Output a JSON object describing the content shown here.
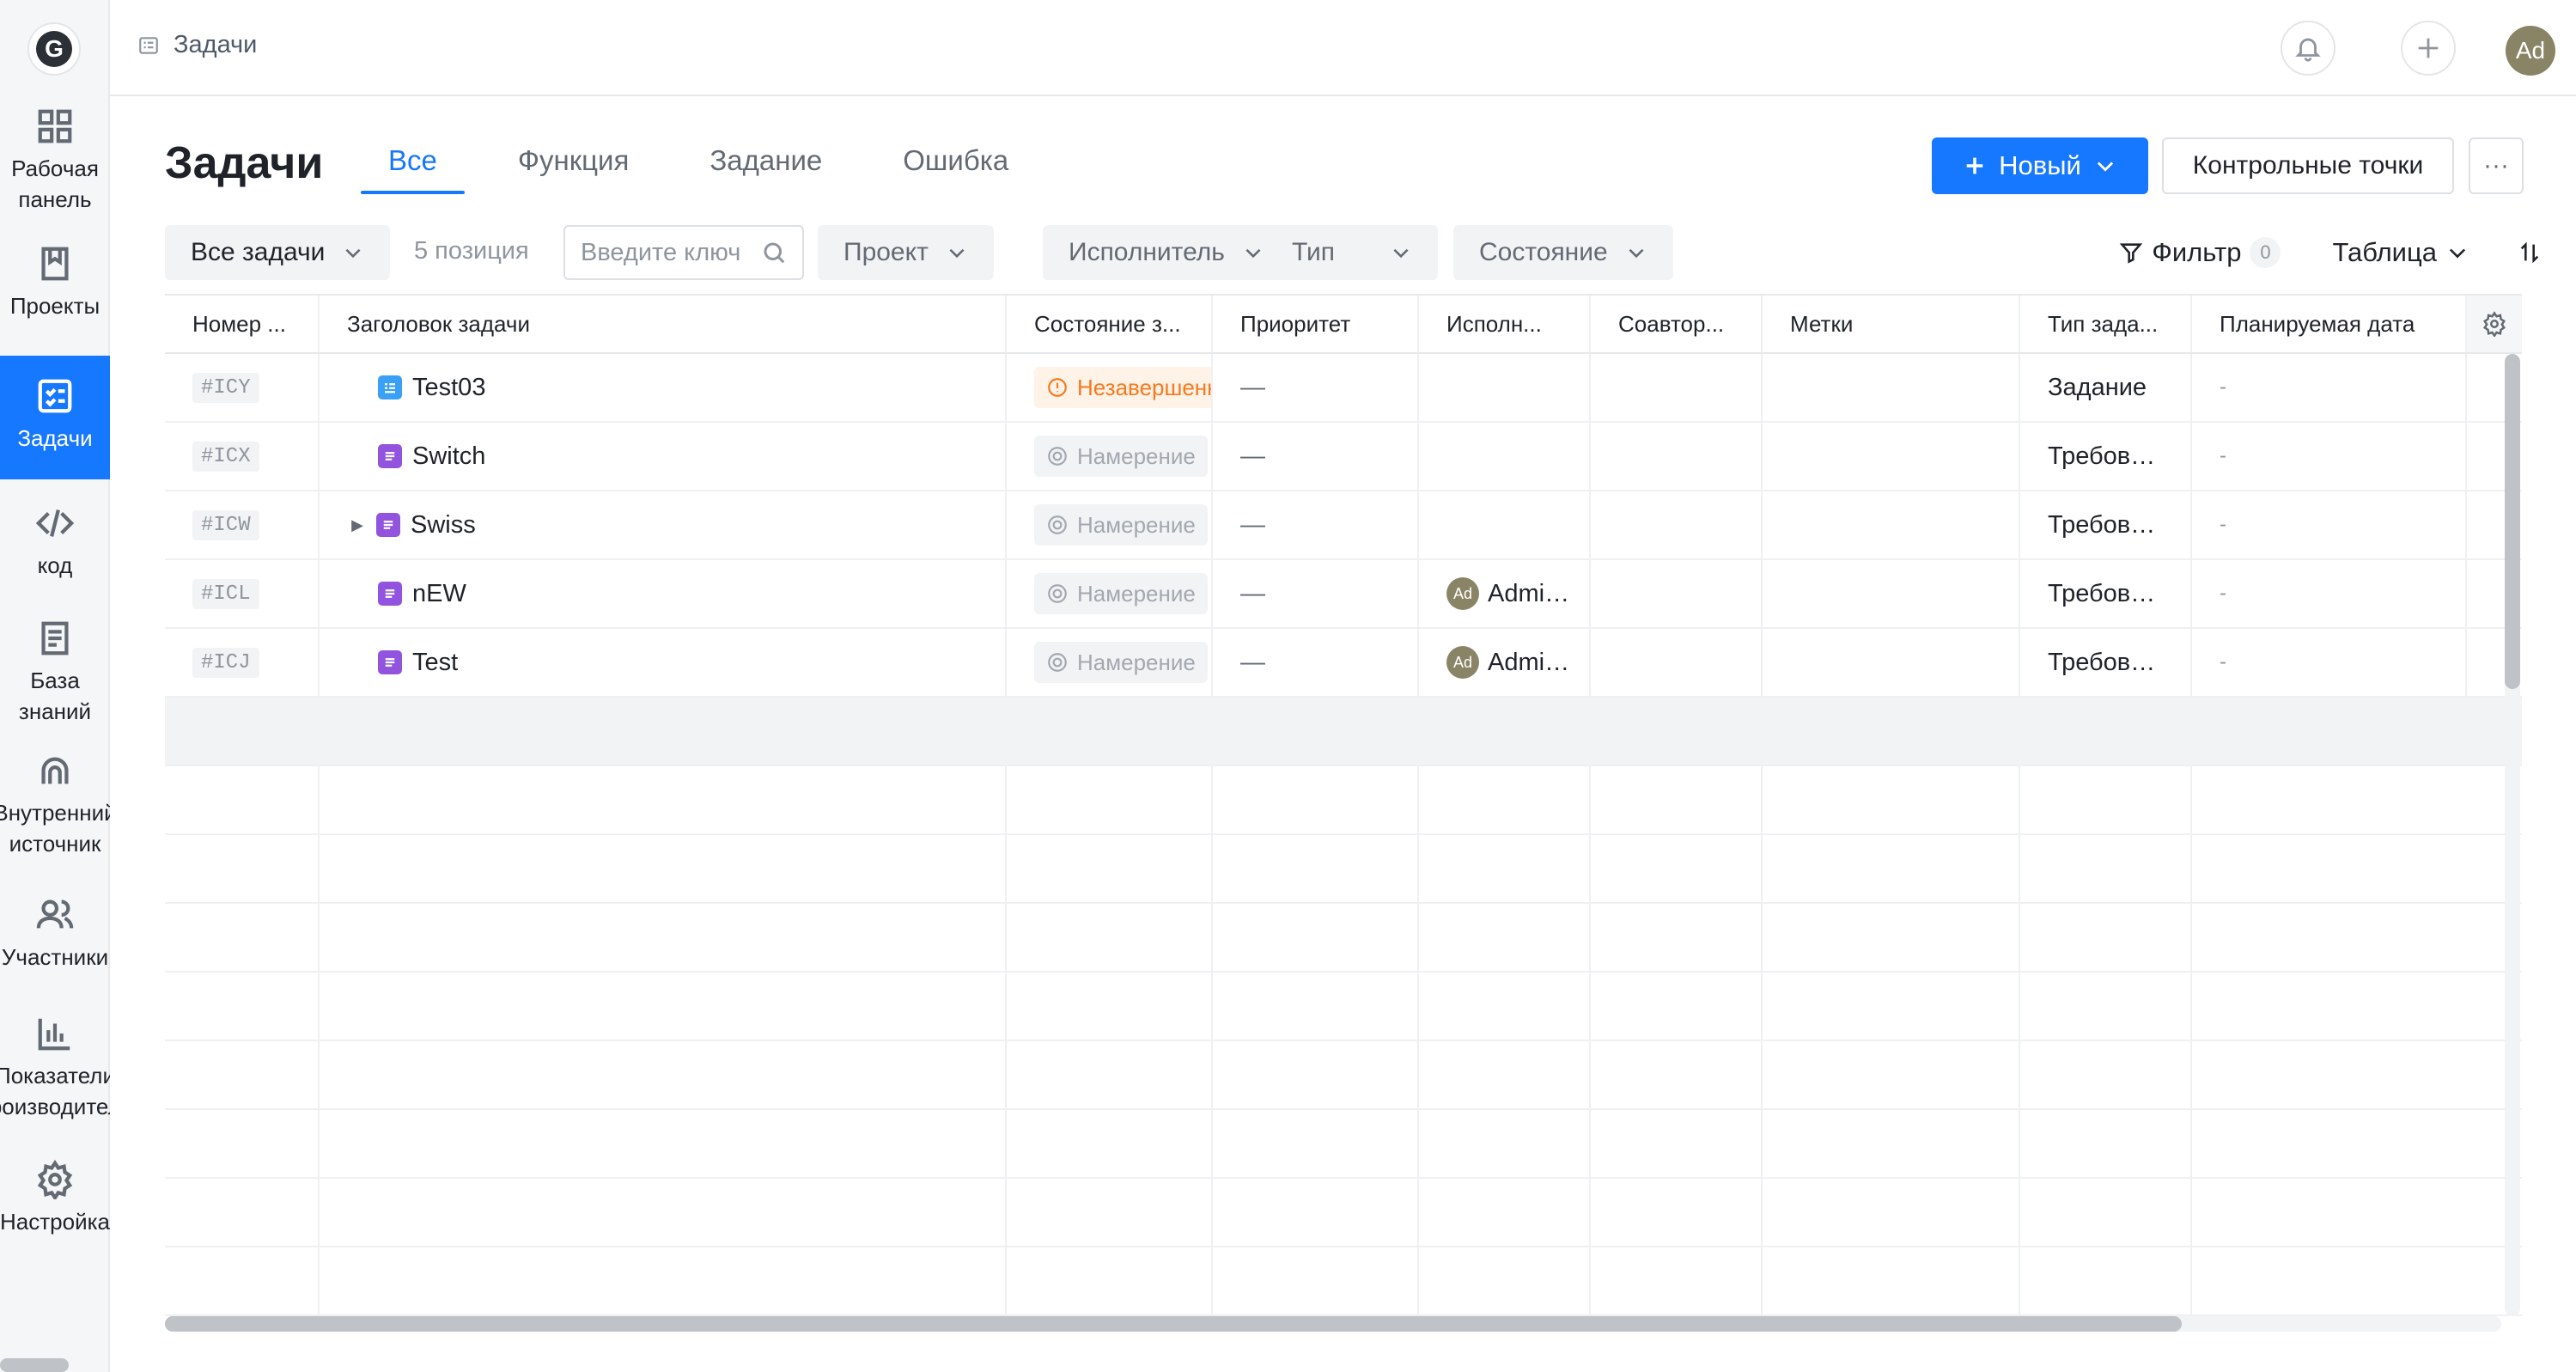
{
  "sidebar": {
    "logo_letter": "G",
    "items": [
      {
        "label": "Рабочая\nпанель",
        "icon": "dashboard-icon"
      },
      {
        "label": "Проекты",
        "icon": "book-icon"
      },
      {
        "label": "Задачи",
        "icon": "tasks-icon"
      },
      {
        "label": "код",
        "icon": "code-icon"
      },
      {
        "label": "База\nзнаний",
        "icon": "document-icon"
      },
      {
        "label": "Внутренний\nисточник",
        "icon": "source-icon"
      },
      {
        "label": "Участники",
        "icon": "members-icon"
      },
      {
        "label": "Показатели\nпроизводитель",
        "icon": "chart-icon"
      },
      {
        "label": "Настройка",
        "icon": "gear-icon"
      }
    ]
  },
  "topbar": {
    "breadcrumb": "Задачи",
    "avatar": "Ad"
  },
  "header": {
    "title": "Задачи",
    "tabs": [
      "Все",
      "Функция",
      "Задание",
      "Ошибка"
    ],
    "new_button": "Новый",
    "checkpoints_button": "Контрольные точки",
    "more_button": "···"
  },
  "filters": {
    "all_tasks": "Все задачи",
    "count": "5 позиция",
    "search_placeholder": "Введите ключ",
    "project": "Проект",
    "assignee": "Исполнитель",
    "type": "Тип",
    "state": "Состояние",
    "filter": "Фильтр",
    "filter_count": "0",
    "view": "Таблица"
  },
  "table": {
    "columns": [
      "Номер ...",
      "Заголовок задачи",
      "Состояние з...",
      "Приоритет",
      "Исполн...",
      "Соавтор...",
      "Метки",
      "Тип зада...",
      "Планируемая дата"
    ],
    "rows": [
      {
        "id": "#ICY",
        "title": "Test03",
        "kind": "task",
        "status": "Незавершенн",
        "status_style": "orange",
        "priority": "—",
        "assignee": "",
        "type": "Задание",
        "date": "-"
      },
      {
        "id": "#ICX",
        "title": "Switch",
        "kind": "req",
        "status": "Намерение",
        "status_style": "grey",
        "priority": "—",
        "assignee": "",
        "type": "Требов…",
        "date": "-"
      },
      {
        "id": "#ICW",
        "title": "Swiss",
        "kind": "req",
        "status": "Намерение",
        "status_style": "grey",
        "priority": "—",
        "assignee": "",
        "type": "Требов…",
        "date": "-",
        "expandable": true
      },
      {
        "id": "#ICL",
        "title": "nEW",
        "kind": "req",
        "status": "Намерение",
        "status_style": "grey",
        "priority": "—",
        "assignee": "Admi…",
        "assignee_avatar": "Ad",
        "type": "Требов…",
        "date": "-"
      },
      {
        "id": "#ICJ",
        "title": "Test",
        "kind": "req",
        "status": "Намерение",
        "status_style": "grey",
        "priority": "—",
        "assignee": "Admi…",
        "assignee_avatar": "Ad",
        "type": "Требов…",
        "date": "-"
      }
    ]
  },
  "colors": {
    "accent": "#1677ff",
    "status_orange": "#f7791e",
    "req_icon": "#9254de",
    "task_icon": "#3aa0f5"
  }
}
